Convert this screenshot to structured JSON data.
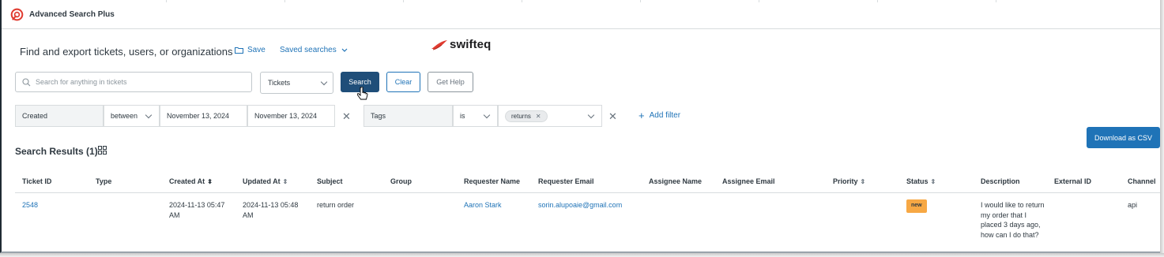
{
  "app": {
    "title": "Advanced Search Plus",
    "brand": "swifteq"
  },
  "header": {
    "headline": "Find and export tickets, users, or organizations",
    "save_label": "Save",
    "saved_searches_label": "Saved searches"
  },
  "search": {
    "placeholder": "Search for anything in tickets",
    "value": "",
    "type_value": "Tickets",
    "search_label": "Search",
    "clear_label": "Clear",
    "help_label": "Get Help"
  },
  "filters": {
    "field1": "Created",
    "op1": "between",
    "from": "November 13, 2024",
    "to": "November 13, 2024",
    "field2": "Tags",
    "op2": "is",
    "tag": "returns",
    "add_label": "Add filter"
  },
  "results": {
    "title": "Search Results (1)",
    "download_label": "Download as CSV",
    "columns": [
      "Ticket ID",
      "Type",
      "Created At",
      "Updated At",
      "Subject",
      "Group",
      "Requester Name",
      "Requester Email",
      "Assignee Name",
      "Assignee Email",
      "Priority",
      "Status",
      "Description",
      "External ID",
      "Channel"
    ],
    "rows": [
      {
        "ticket_id": "2548",
        "type": "",
        "created_at": "2024-11-13 05:47 AM",
        "updated_at": "2024-11-13 05:48 AM",
        "subject": "return order",
        "group": "",
        "requester_name": "Aaron Stark",
        "requester_email": "sorin.alupoaie@gmail.com",
        "assignee_name": "",
        "assignee_email": "",
        "priority": "",
        "status": "new",
        "description": "I would like to return my order that I placed 3 days ago, how can I do that?",
        "external_id": "",
        "channel": "api"
      }
    ]
  },
  "colors": {
    "primary": "#1f4e79",
    "link": "#1f73b7",
    "status_new": "#f7a844",
    "brand_red": "#e03c31"
  },
  "icons": [
    "app-logo-icon",
    "folder-icon",
    "chevron-down-icon",
    "search-icon",
    "close-icon",
    "plus-icon",
    "grid-icon",
    "sort-icon",
    "cursor-icon",
    "swifteq-logo-icon"
  ]
}
